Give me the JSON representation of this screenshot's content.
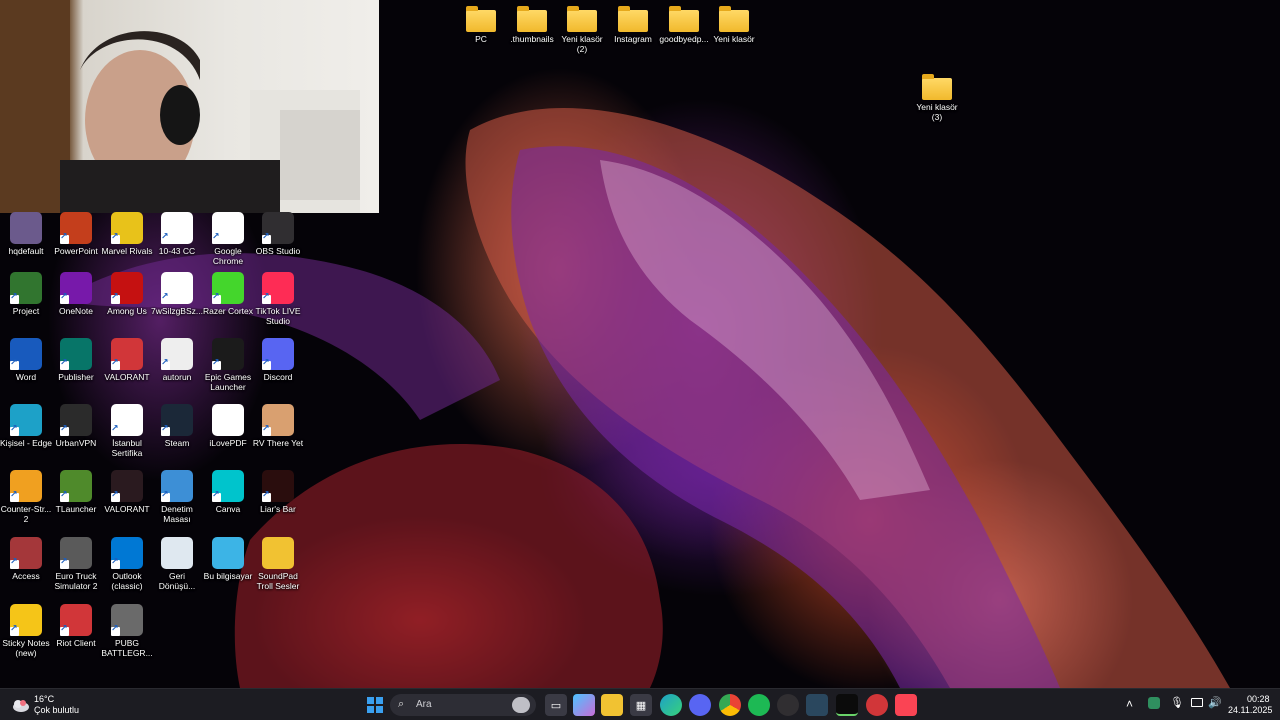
{
  "desktop_icons_left": [
    {
      "label": "hqdefault",
      "icon": "image-file-icon",
      "color": "#6b5a8c"
    },
    {
      "label": "PowerPoint",
      "icon": "powerpoint-icon",
      "color": "#c43e1c"
    },
    {
      "label": "Marvel Rivals",
      "icon": "marvel-rivals-icon",
      "color": "#e8c21a"
    },
    {
      "label": "10-43 CC",
      "icon": "chrome-icon",
      "color": "#ffffff"
    },
    {
      "label": "Google Chrome",
      "icon": "chrome-icon",
      "color": "#ffffff"
    },
    {
      "label": "OBS Studio",
      "icon": "obs-icon",
      "color": "#302e31"
    },
    {
      "label": "Project",
      "icon": "project-icon",
      "color": "#31752f"
    },
    {
      "label": "OneNote",
      "icon": "onenote-icon",
      "color": "#7719aa"
    },
    {
      "label": "Among Us",
      "icon": "among-us-icon",
      "color": "#c51111"
    },
    {
      "label": "7wSilzgBSz...",
      "icon": "chrome-file-icon",
      "color": "#ffffff"
    },
    {
      "label": "Razer Cortex",
      "icon": "razer-cortex-icon",
      "color": "#44d62c"
    },
    {
      "label": "TikTok LIVE Studio",
      "icon": "tiktok-icon",
      "color": "#fe2c55"
    },
    {
      "label": "Word",
      "icon": "word-icon",
      "color": "#185abd"
    },
    {
      "label": "Publisher",
      "icon": "publisher-icon",
      "color": "#077568"
    },
    {
      "label": "VALORANT",
      "icon": "riot-icon",
      "color": "#d13639"
    },
    {
      "label": "autorun",
      "icon": "autorun-file-icon",
      "color": "#eeeeee"
    },
    {
      "label": "Epic Games Launcher",
      "icon": "epic-games-icon",
      "color": "#1b1b1b"
    },
    {
      "label": "Discord",
      "icon": "discord-icon",
      "color": "#5865f2"
    },
    {
      "label": "Kişisel - Edge",
      "icon": "edge-icon",
      "color": "#1da1c8"
    },
    {
      "label": "UrbanVPN",
      "icon": "urbanvpn-icon",
      "color": "#2b2b2b"
    },
    {
      "label": "İstanbul Sertifika",
      "icon": "chrome-file-icon",
      "color": "#ffffff"
    },
    {
      "label": "Steam",
      "icon": "steam-icon",
      "color": "#1b2838"
    },
    {
      "label": "iLovePDF",
      "icon": "blank-file-icon",
      "color": "#ffffff"
    },
    {
      "label": "RV There Yet",
      "icon": "rv-there-yet-icon",
      "color": "#d9a070"
    },
    {
      "label": "Counter-Str... 2",
      "icon": "counter-strike-icon",
      "color": "#f0a020"
    },
    {
      "label": "TLauncher",
      "icon": "tlauncher-icon",
      "color": "#4f8a2b"
    },
    {
      "label": "VALORANT",
      "icon": "valorant-icon",
      "color": "#2a1a1f"
    },
    {
      "label": "Denetim Masası",
      "icon": "control-panel-icon",
      "color": "#3d8fd6"
    },
    {
      "label": "Canva",
      "icon": "canva-icon",
      "color": "#00c4cc"
    },
    {
      "label": "Liar's Bar",
      "icon": "liars-bar-icon",
      "color": "#2a0d0d"
    },
    {
      "label": "Access",
      "icon": "access-icon",
      "color": "#a4373a"
    },
    {
      "label": "Euro Truck Simulator 2",
      "icon": "euro-truck-icon",
      "color": "#5a5a5a"
    },
    {
      "label": "Outlook (classic)",
      "icon": "outlook-icon",
      "color": "#0078d4"
    },
    {
      "label": "Geri Dönüşü...",
      "icon": "recycle-bin-icon",
      "color": "#dfe8f0"
    },
    {
      "label": "Bu bilgisayar",
      "icon": "this-pc-icon",
      "color": "#3cb4e6"
    },
    {
      "label": "SoundPad Troll Sesler",
      "icon": "folder-icon",
      "color": "#f1c232"
    },
    {
      "label": "Sticky Notes (new)",
      "icon": "sticky-notes-icon",
      "color": "#f5c518"
    },
    {
      "label": "Riot Client",
      "icon": "riot-icon",
      "color": "#d13639"
    },
    {
      "label": "PUBG BATTLEGR...",
      "icon": "pubg-icon",
      "color": "#6a6a6a"
    }
  ],
  "desktop_icons_top": [
    {
      "label": "PC",
      "icon": "folder-icon"
    },
    {
      "label": ".thumbnails",
      "icon": "folder-icon"
    },
    {
      "label": "Yeni klasör (2)",
      "icon": "folder-icon"
    },
    {
      "label": "Instagram",
      "icon": "folder-icon"
    },
    {
      "label": "goodbyedp...",
      "icon": "folder-icon"
    },
    {
      "label": "Yeni klasör",
      "icon": "folder-icon"
    }
  ],
  "desktop_icon_right": {
    "label": "Yeni klasör (3)",
    "icon": "folder-icon"
  },
  "taskbar": {
    "weather": {
      "temp": "16°C",
      "condition": "Çok bulutlu",
      "icon": "cloud-weather-icon"
    },
    "search_placeholder": "Ara",
    "clock": {
      "time": "00:28",
      "date": "24.11.2025"
    },
    "accent": "#0078d4",
    "apps": [
      "start-icon",
      "task-view-icon",
      "copilot-icon",
      "file-explorer-icon",
      "microsoft-store-icon",
      "edge-icon",
      "discord-icon",
      "chrome-icon",
      "spotify-icon",
      "obs-icon",
      "steam-icon",
      "terminal-icon",
      "riot-icon",
      "valorant-icon"
    ],
    "tray": [
      "chevron-up-icon",
      "security-icon",
      "microphone-icon",
      "display-icon",
      "volume-icon"
    ]
  },
  "webcam": {
    "icon": "webcam-overlay-icon"
  }
}
